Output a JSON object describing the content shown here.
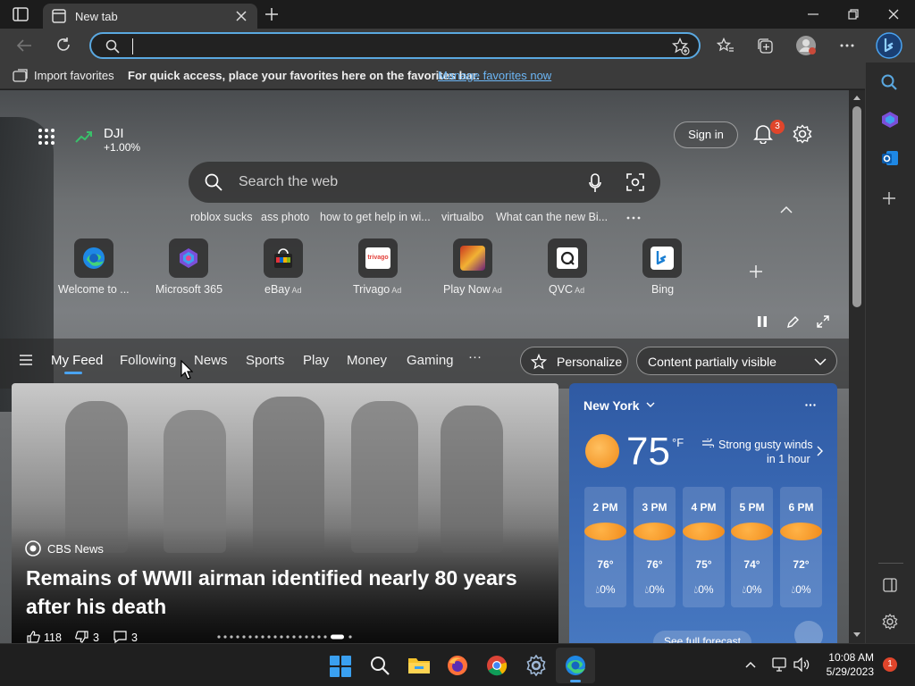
{
  "browser": {
    "tab_title": "New tab",
    "address_value": "",
    "favorites_bar": {
      "import_label": "Import favorites",
      "message": "For quick access, place your favorites here on the favorites bar.",
      "link": "Manage favorites now"
    }
  },
  "newtab": {
    "stock": {
      "symbol": "DJI",
      "change": "+1.00%"
    },
    "sign_in": "Sign in",
    "notifications_count": "3",
    "search_placeholder": "Search the web",
    "suggestions": [
      "roblox sucks",
      "ass photo",
      "how to get help in wi...",
      "virtualbo",
      "What can the new Bi..."
    ],
    "quick_links": [
      {
        "label": "Welcome to ...",
        "ad": ""
      },
      {
        "label": "Microsoft 365",
        "ad": ""
      },
      {
        "label": "eBay",
        "ad": "Ad"
      },
      {
        "label": "Trivago",
        "ad": "Ad"
      },
      {
        "label": "Play Now",
        "ad": "Ad"
      },
      {
        "label": "QVC",
        "ad": "Ad"
      },
      {
        "label": "Bing",
        "ad": ""
      }
    ],
    "trivago_tile_text": "trivago",
    "nav_tabs": [
      "My Feed",
      "Following",
      "News",
      "Sports",
      "Play",
      "Money",
      "Gaming"
    ],
    "nav_more": "···",
    "personalize": "Personalize",
    "content_visibility": "Content partially visible"
  },
  "article": {
    "source": "CBS News",
    "headline": "Remains of WWII airman identified nearly 80 years after his death",
    "likes": "118",
    "dislikes": "3",
    "comments": "3"
  },
  "weather": {
    "location": "New York",
    "temperature": "75",
    "unit": "°F",
    "alert_line1": "Strong gusty winds",
    "alert_line2": "in 1 hour",
    "hourly": [
      {
        "time": "2 PM",
        "temp": "76°",
        "precip": "0%"
      },
      {
        "time": "3 PM",
        "temp": "76°",
        "precip": "0%"
      },
      {
        "time": "4 PM",
        "temp": "75°",
        "precip": "0%"
      },
      {
        "time": "5 PM",
        "temp": "74°",
        "precip": "0%"
      },
      {
        "time": "6 PM",
        "temp": "72°",
        "precip": "0%"
      }
    ],
    "forecast_button": "See full forecast"
  },
  "taskbar": {
    "time": "10:08 AM",
    "date": "5/29/2023",
    "notification_count": "1"
  },
  "colors": {
    "accent": "#4aa3f0",
    "weather_bg": "#3a63a8",
    "badge": "#e0452b"
  }
}
